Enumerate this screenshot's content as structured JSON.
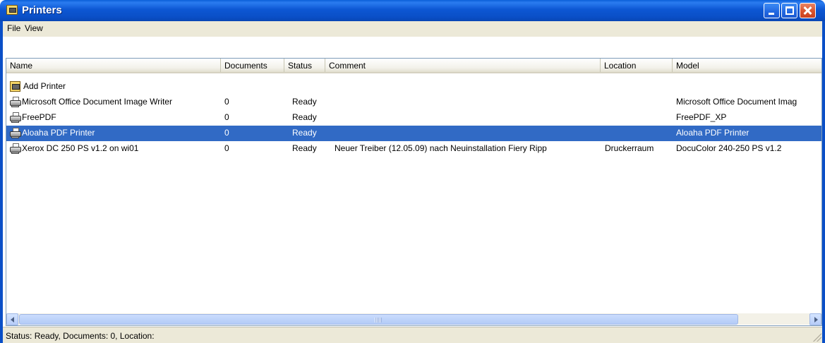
{
  "window": {
    "title": "Printers"
  },
  "menu": {
    "items": [
      "File",
      "View"
    ]
  },
  "columns": [
    "Name",
    "Documents",
    "Status",
    "Comment",
    "Location",
    "Model"
  ],
  "rows": [
    {
      "name": "Add Printer",
      "documents": "",
      "status": "",
      "comment": "",
      "location": "",
      "model": "",
      "icon": "add-printer-icon"
    },
    {
      "name": "Microsoft Office Document Image Writer",
      "documents": "0",
      "status": "Ready",
      "comment": "",
      "location": "",
      "model": "Microsoft Office Document Imag",
      "icon": "printer-icon"
    },
    {
      "name": "FreePDF",
      "documents": "0",
      "status": "Ready",
      "comment": "",
      "location": "",
      "model": "FreePDF_XP",
      "icon": "printer-icon"
    },
    {
      "name": "Aloaha PDF Printer",
      "documents": "0",
      "status": "Ready",
      "comment": "",
      "location": "",
      "model": "Aloaha PDF Printer",
      "icon": "printer-icon",
      "selected": true
    },
    {
      "name": "Xerox DC 250 PS v1.2 on wi01",
      "documents": "0",
      "status": "Ready",
      "comment": "Neuer Treiber (12.05.09) nach Neuinstallation Fiery Ripp",
      "location": "Druckerraum",
      "model": "DocuColor 240-250 PS v1.2",
      "icon": "network-printer-icon"
    }
  ],
  "statusbar": {
    "text": "Status: Ready, Documents: 0, Location:"
  },
  "colors": {
    "titlebar": "#0a4fc7",
    "selection": "#316ac5",
    "chrome": "#ece9d8"
  }
}
